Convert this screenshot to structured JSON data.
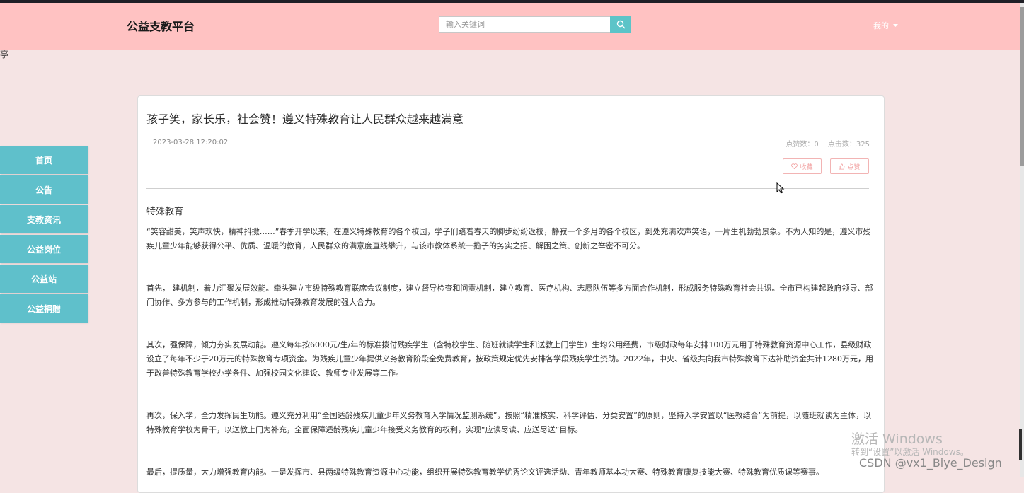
{
  "header": {
    "brand": "公益支教平台",
    "search_placeholder": "输入关键词",
    "user_menu_label": "我的"
  },
  "stray_char": "亭",
  "sidebar": {
    "items": [
      {
        "label": "首页"
      },
      {
        "label": "公告"
      },
      {
        "label": "支教资讯"
      },
      {
        "label": "公益岗位"
      },
      {
        "label": "公益站"
      },
      {
        "label": "公益捐赠"
      }
    ]
  },
  "article": {
    "title": "孩子笑，家长乐，社会赞！遵义特殊教育让人民群众越来越满意",
    "date": "2023-03-28 12:20:02",
    "likes_label": "点赞数：0",
    "clicks_label": "点击数：325",
    "fav_label": "收藏",
    "like_label": "点赞",
    "section": "特殊教育",
    "paragraphs": [
      "“笑容甜美，笑声欢快，精神抖擞……”春季开学以来，在遵义特殊教育的各个校园，学子们踏着春天的脚步纷纷返校，静寂一个多月的各个校区，到处充满欢声笑语，一片生机勃勃景象。不为人知的是，遵义市残疾儿童少年能够获得公平、优质、温暖的教育，人民群众的满意度直线攀升，与该市教体系统一揽子的务实之招、解困之策、创新之举密不可分。",
      "首先， 建机制，着力汇聚发展效能。牵头建立市级特殊教育联席会议制度，建立督导检查和问责机制，建立教育、医疗机构、志愿队伍等多方面合作机制，形成服务特殊教育社会共识。全市已构建起政府领导、部门协作、多方参与的工作机制，形成推动特殊教育发展的强大合力。",
      "其次，强保障，倾力夯实发展动能。遵义每年按6000元/生/年的标准拨付残疾学生（含特校学生、随班就读学生和送教上门学生）生均公用经费，市级财政每年安排100万元用于特殊教育资源中心工作，县级财政设立了每年不少于20万元的特殊教育专项资金。为残疾儿童少年提供义务教育阶段全免费教育，按政策规定优先安排各学段残疾学生资助。2022年，中央、省级共向我市特殊教育下达补助资金共计1280万元，用于改善特殊教育学校办学条件、加强校园文化建设、教师专业发展等工作。",
      "再次，保入学，全力发挥民生功能。遵义充分利用“全国适龄残疾儿童少年义务教育入学情况监测系统”，按照“精准核实、科学评估、分类安置”的原则，坚持入学安置以“医教结合”为前提，以随班就读为主体，以特殊教育学校为骨干，以送教上门为补充，全面保障适龄残疾儿童少年接受义务教育的权利，实现“应读尽读、应送尽送”目标。",
      "最后，提质量，大力增强教育内能。一是发挥市、县两级特殊教育资源中心功能，组织开展特殊教育教学优秀论文评选活动、青年教师基本功大赛、特殊教育康复技能大赛、特殊教育优质课等赛事。"
    ]
  },
  "watermark": {
    "line1": "激活 Windows",
    "line2": "转到“设置”以激活 Windows。",
    "csdn": "CSDN @vx1_Biye_Design"
  },
  "colors": {
    "header_bg": "#ffc2c2",
    "page_bg": "#f5e4e4",
    "nav_bg": "#5fc0cb",
    "search_btn": "#5cc4c8",
    "pink_button": "#f2a3a3"
  }
}
